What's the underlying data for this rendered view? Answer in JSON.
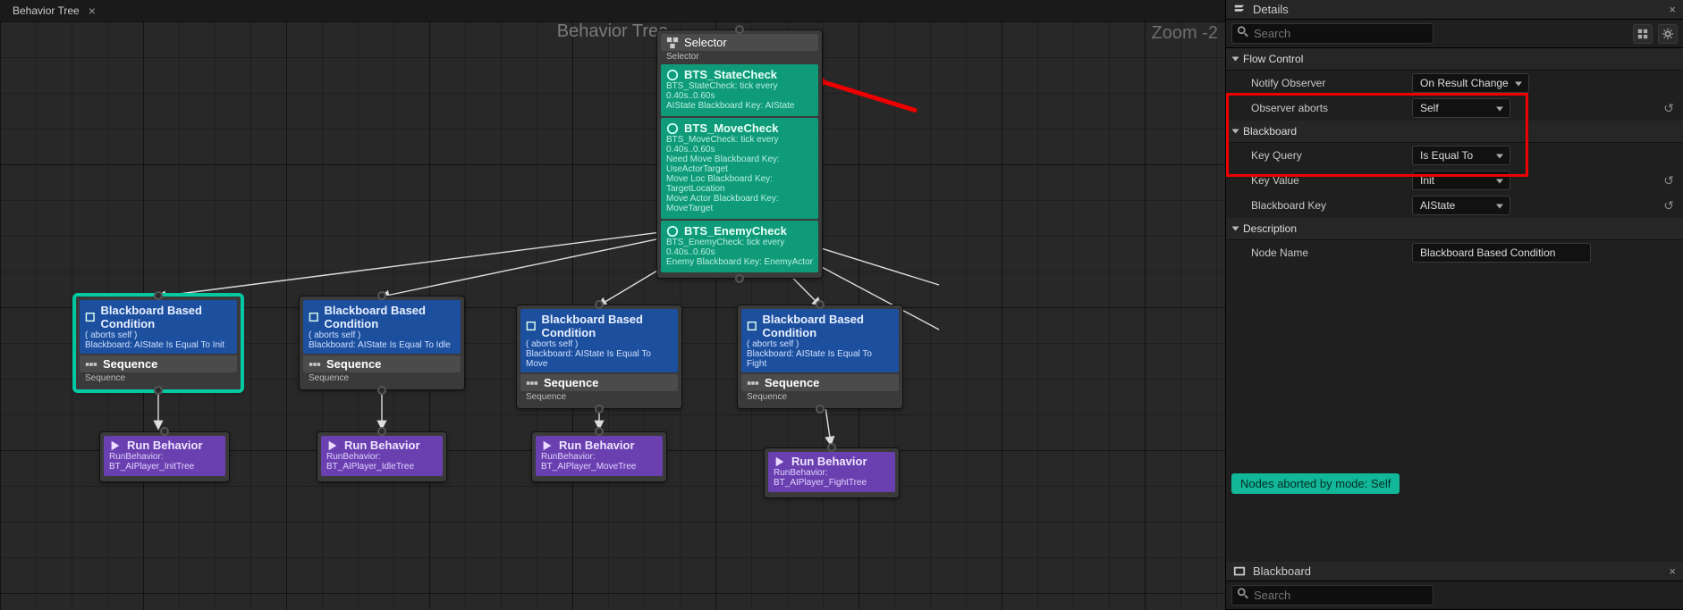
{
  "tabs": {
    "bt": "Behavior Tree"
  },
  "graph": {
    "title": "Behavior Tree",
    "zoom": "Zoom -2"
  },
  "selector": {
    "title": "Selector",
    "subtitle": "Selector",
    "services": [
      {
        "title": "BTS_StateCheck",
        "lines": [
          "BTS_StateCheck: tick every 0.40s..0.60s",
          "AIState Blackboard Key: AIState"
        ]
      },
      {
        "title": "BTS_MoveCheck",
        "lines": [
          "BTS_MoveCheck: tick every 0.40s..0.60s",
          "Need Move Blackboard Key: UseActorTarget",
          "Move Loc Blackboard Key: TargetLocation",
          "Move Actor Blackboard Key: MoveTarget"
        ]
      },
      {
        "title": "BTS_EnemyCheck",
        "lines": [
          "BTS_EnemyCheck: tick every 0.40s..0.60s",
          "Enemy Blackboard Key: EnemyActor"
        ]
      }
    ]
  },
  "children": [
    {
      "decor": {
        "title": "Blackboard Based Condition",
        "aborts": "( aborts self )",
        "cond": "Blackboard: AIState Is Equal To Init"
      },
      "seqTitle": "Sequence",
      "seqSub": "Sequence",
      "run": {
        "title": "Run Behavior",
        "sub": "RunBehavior: BT_AIPlayer_InitTree"
      }
    },
    {
      "decor": {
        "title": "Blackboard Based Condition",
        "aborts": "( aborts self )",
        "cond": "Blackboard: AIState Is Equal To Idle"
      },
      "seqTitle": "Sequence",
      "seqSub": "Sequence",
      "run": {
        "title": "Run Behavior",
        "sub": "RunBehavior: BT_AIPlayer_IdleTree"
      }
    },
    {
      "decor": {
        "title": "Blackboard Based Condition",
        "aborts": "( aborts self )",
        "cond": "Blackboard: AIState Is Equal To Move"
      },
      "seqTitle": "Sequence",
      "seqSub": "Sequence",
      "run": {
        "title": "Run Behavior",
        "sub": "RunBehavior: BT_AIPlayer_MoveTree"
      }
    },
    {
      "decor": {
        "title": "Blackboard Based Condition",
        "aborts": "( aborts self )",
        "cond": "Blackboard: AIState Is Equal To Fight"
      },
      "seqTitle": "Sequence",
      "seqSub": "Sequence",
      "run": {
        "title": "Run Behavior",
        "sub": "RunBehavior: BT_AIPlayer_FightTree"
      }
    }
  ],
  "details": {
    "tab": "Details",
    "searchPlaceholder": "Search",
    "sections": {
      "flow": "Flow Control",
      "bb": "Blackboard",
      "desc": "Description"
    },
    "props": {
      "notifyObserver": {
        "label": "Notify Observer",
        "value": "On Result Change"
      },
      "observerAborts": {
        "label": "Observer aborts",
        "value": "Self"
      },
      "keyQuery": {
        "label": "Key Query",
        "value": "Is Equal To"
      },
      "keyValue": {
        "label": "Key Value",
        "value": "Init"
      },
      "blackboardKey": {
        "label": "Blackboard Key",
        "value": "AIState"
      },
      "nodeName": {
        "label": "Node Name",
        "value": "Blackboard Based Condition"
      }
    },
    "status": "Nodes aborted by mode: Self",
    "bbTab": "Blackboard",
    "bbSearchPlaceholder": "Search"
  }
}
